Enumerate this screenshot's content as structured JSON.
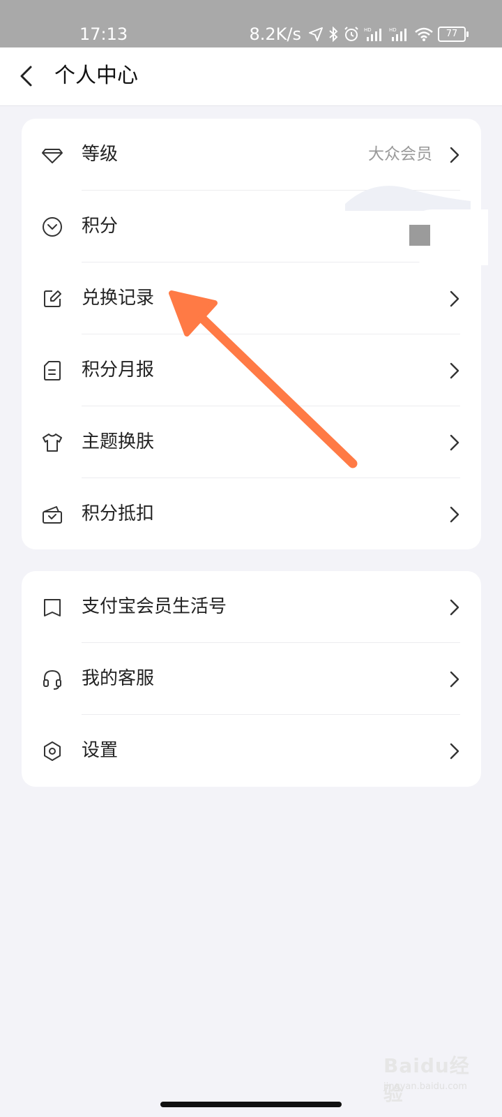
{
  "status_bar": {
    "time": "17:13",
    "network_speed": "8.2K/s",
    "battery": "77",
    "icons": [
      "location-arrow-icon",
      "bluetooth-icon",
      "alarm-icon",
      "hd-signal-icon",
      "hd-signal-icon",
      "wifi-icon",
      "battery-icon"
    ]
  },
  "nav": {
    "title": "个人中心",
    "back_icon": "chevron-left-icon"
  },
  "card1": {
    "items": [
      {
        "icon": "diamond-icon",
        "label": "等级",
        "value": "大众会员"
      },
      {
        "icon": "circle-chevron-down-icon",
        "label": "积分"
      },
      {
        "icon": "edit-icon",
        "label": "兑换记录"
      },
      {
        "icon": "report-document-icon",
        "label": "积分月报"
      },
      {
        "icon": "tshirt-icon",
        "label": "主题换肤"
      },
      {
        "icon": "wallet-icon",
        "label": "积分抵扣"
      }
    ]
  },
  "card2": {
    "items": [
      {
        "icon": "bookmark-icon",
        "label": "支付宝会员生活号"
      },
      {
        "icon": "headset-icon",
        "label": "我的客服"
      },
      {
        "icon": "hexagon-settings-icon",
        "label": "设置"
      }
    ]
  },
  "watermark": {
    "brand": "Baidu经验",
    "url": "jingyan.baidu.com"
  },
  "colors": {
    "page_bg": "#f3f3f8",
    "card_bg": "#ffffff",
    "status_bar_bg": "#a9a9a9",
    "annotation_arrow": "#ff7a45"
  }
}
